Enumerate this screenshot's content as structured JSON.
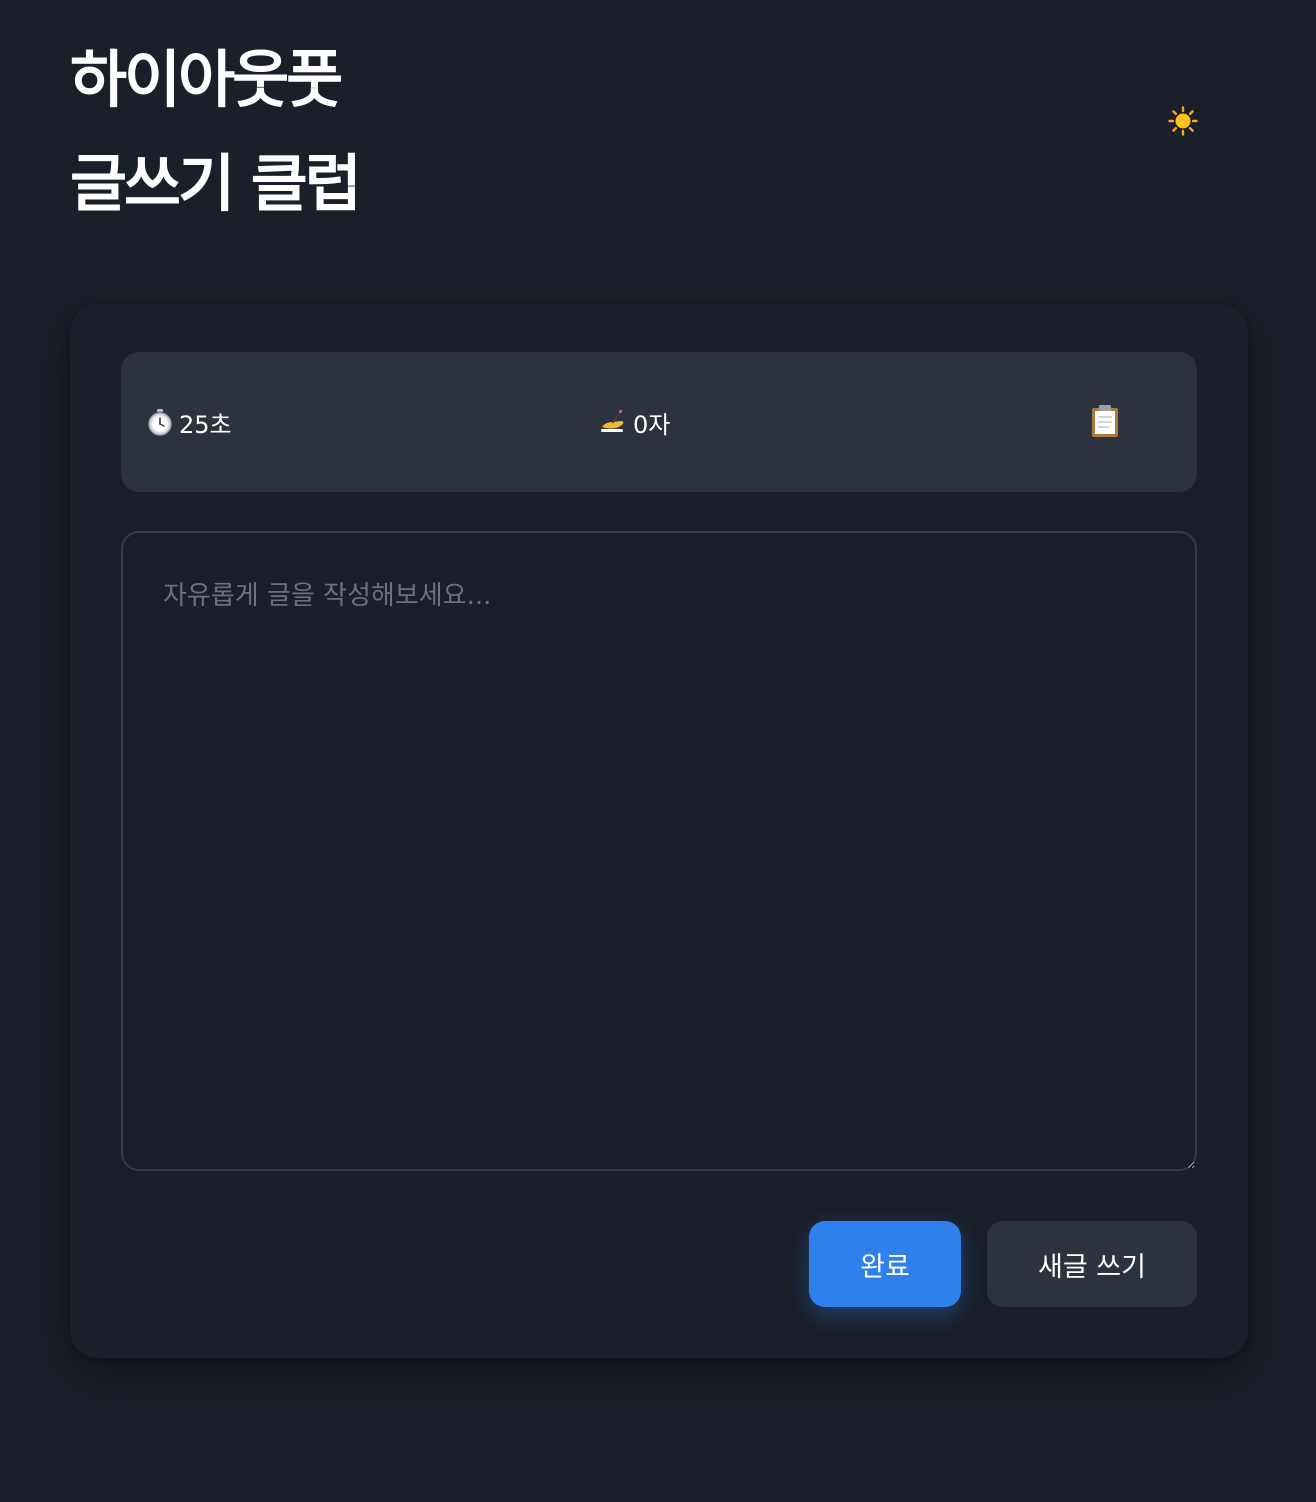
{
  "header": {
    "title_line1": "하이아웃풋",
    "title_line2": "글쓰기 클럽",
    "theme_toggle_icon": "sun-icon"
  },
  "stats": {
    "timer_icon": "stopwatch-icon",
    "timer_text": "25초",
    "count_icon": "writing-hand-icon",
    "count_text": "0자",
    "copy_icon": "clipboard-icon"
  },
  "editor": {
    "placeholder": "자유롭게 글을 작성해보세요...",
    "value": ""
  },
  "actions": {
    "done_label": "완료",
    "new_label": "새글 쓰기"
  },
  "colors": {
    "background": "#1a1f29",
    "panel": "#2c323e",
    "accent": "#2f80ed",
    "placeholder": "#6c717c"
  }
}
